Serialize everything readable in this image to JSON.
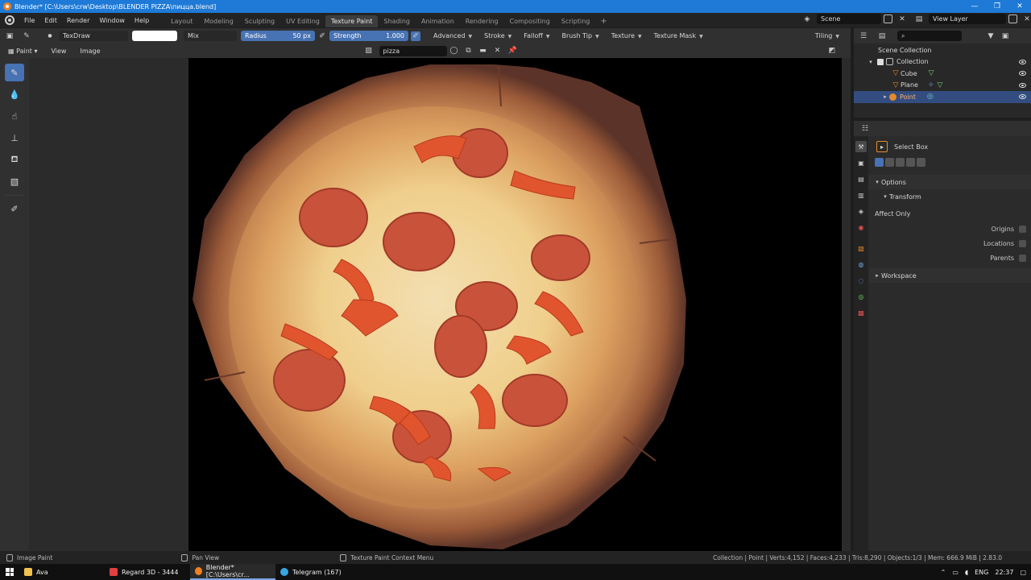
{
  "window": {
    "title": "Blender* [C:\\Users\\crw\\Desktop\\BLENDER PIZZA\\пицца.blend]",
    "controls": [
      "—",
      "❐",
      "✕"
    ]
  },
  "menu": [
    "File",
    "Edit",
    "Render",
    "Window",
    "Help"
  ],
  "workspace_tabs": [
    {
      "label": "Layout",
      "active": false
    },
    {
      "label": "Modeling",
      "active": false
    },
    {
      "label": "Sculpting",
      "active": false
    },
    {
      "label": "UV Editing",
      "active": false
    },
    {
      "label": "Texture Paint",
      "active": true
    },
    {
      "label": "Shading",
      "active": false
    },
    {
      "label": "Animation",
      "active": false
    },
    {
      "label": "Rendering",
      "active": false
    },
    {
      "label": "Compositing",
      "active": false
    },
    {
      "label": "Scripting",
      "active": false
    }
  ],
  "workspace_add": "+",
  "scene": {
    "name": "Scene",
    "view_layer": "View Layer"
  },
  "tool_header": {
    "brush_name": "TexDraw",
    "color_hex": "#ffffff",
    "blend_mode": "Mix",
    "radius_label": "Radius",
    "radius_value": "50 px",
    "strength_label": "Strength",
    "strength_value": "1.000",
    "menus": [
      "Advanced",
      "Stroke",
      "Falloff",
      "Brush Tip",
      "Texture",
      "Texture Mask"
    ],
    "tiling": "Tiling"
  },
  "sub_header": {
    "mode": "Paint",
    "view": "View",
    "image": "Image",
    "image_name": "pizza"
  },
  "tools": [
    "draw-brush",
    "soften-brush",
    "smear-brush",
    "clone-brush",
    "fill-brush",
    "mask-brush",
    "annotate"
  ],
  "outliner": {
    "root": "Scene Collection",
    "rows": [
      {
        "label": "Collection",
        "kind": "collection",
        "selected": false
      },
      {
        "label": "Cube",
        "kind": "mesh",
        "selected": false
      },
      {
        "label": "Plane",
        "kind": "mesh",
        "selected": false
      },
      {
        "label": "Point",
        "kind": "light",
        "selected": true
      }
    ]
  },
  "properties": {
    "active_tool": "Select Box",
    "options_label": "Options",
    "transform_label": "Transform",
    "affect_only": "Affect Only",
    "checkboxes": [
      "Origins",
      "Locations",
      "Parents"
    ],
    "workspace_label": "Workspace"
  },
  "status": {
    "left": "Image Paint",
    "middle": "Pan View",
    "context": "Texture Paint Context Menu",
    "stats": "Collection | Point | Verts:4,152 | Faces:4,233 | Tris:8,290 | Objects:1/3 | Mem: 666.9 MiB | 2.83.0"
  },
  "taskbar": {
    "items": [
      {
        "label": "Ava",
        "color": "#f2c14e",
        "active": false
      },
      {
        "label": "Regard 3D - 3444",
        "color": "#e04040",
        "active": false
      },
      {
        "label": "Blender* [C:\\Users\\cr...",
        "color": "#f08020",
        "active": true
      },
      {
        "label": "Telegram (167)",
        "color": "#3aa6e0",
        "active": false
      }
    ],
    "lang": "ENG",
    "time": "22:37"
  },
  "colors": {
    "accent": "#4772b3",
    "selection": "#334d80",
    "titlebar": "#1e7ad6"
  }
}
